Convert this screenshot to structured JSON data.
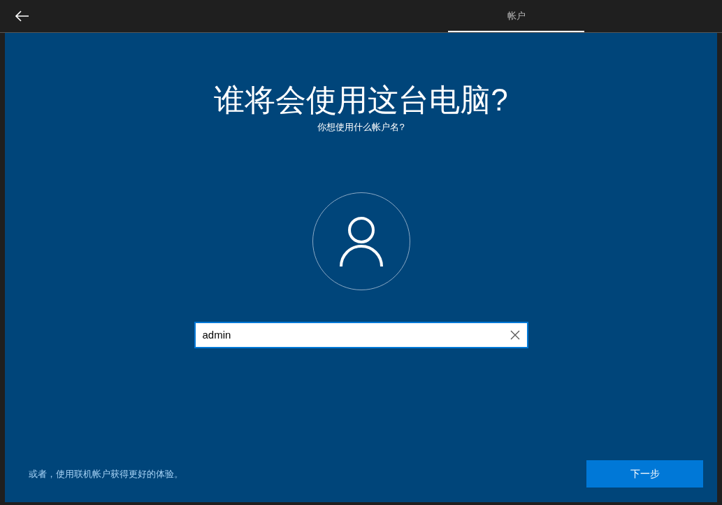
{
  "tabs": [
    {
      "label": "帐户",
      "selected": true
    }
  ],
  "title": "谁将会使用这台电脑?",
  "subtitle": "你想使用什么帐户名?",
  "name_field": {
    "value": "admin",
    "focused": true
  },
  "online_account_link": "或者，使用联机帐户获得更好的体验。",
  "next_button": "下一步"
}
